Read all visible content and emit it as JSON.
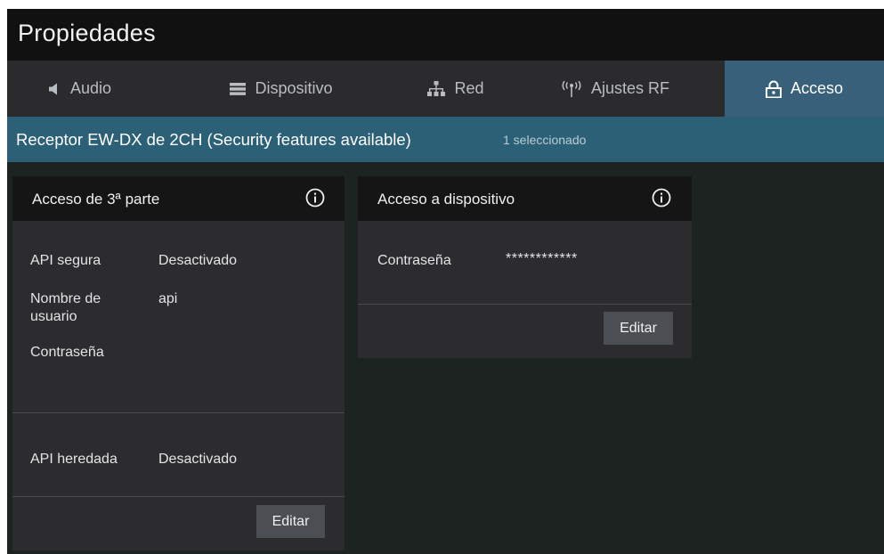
{
  "window": {
    "title": "Propiedades"
  },
  "tabs": [
    {
      "label": "Audio",
      "icon": "speaker-icon",
      "active": false
    },
    {
      "label": "Dispositivo",
      "icon": "device-icon",
      "active": false
    },
    {
      "label": "Red",
      "icon": "network-icon",
      "active": false
    },
    {
      "label": "Ajustes RF",
      "icon": "antenna-icon",
      "active": false
    },
    {
      "label": "Acceso",
      "icon": "lock-icon",
      "active": true
    }
  ],
  "subheader": {
    "title": "Receptor EW-DX de 2CH (Security features available)",
    "count": "1 seleccionado"
  },
  "third_party": {
    "title": "Acceso de 3ª parte",
    "rows": [
      {
        "label": "API segura",
        "value": "Desactivado"
      },
      {
        "label": "Nombre de usuario",
        "value": "api"
      },
      {
        "label": "Contraseña",
        "value": ""
      }
    ],
    "legacy": {
      "label": "API heredada",
      "value": "Desactivado"
    },
    "edit_label": "Editar"
  },
  "device_access": {
    "title": "Acceso a dispositivo",
    "password_label": "Contraseña",
    "password_value": "************",
    "edit_label": "Editar"
  },
  "colors": {
    "title_bar": "#111111",
    "tab_bar": "#2b2b2e",
    "tab_active": "#38607a",
    "subheader": "#2c6077",
    "panel_bg": "#1d2321",
    "card_bg": "#2c2c2f",
    "card_header": "#151515",
    "button": "#4b4e52"
  }
}
